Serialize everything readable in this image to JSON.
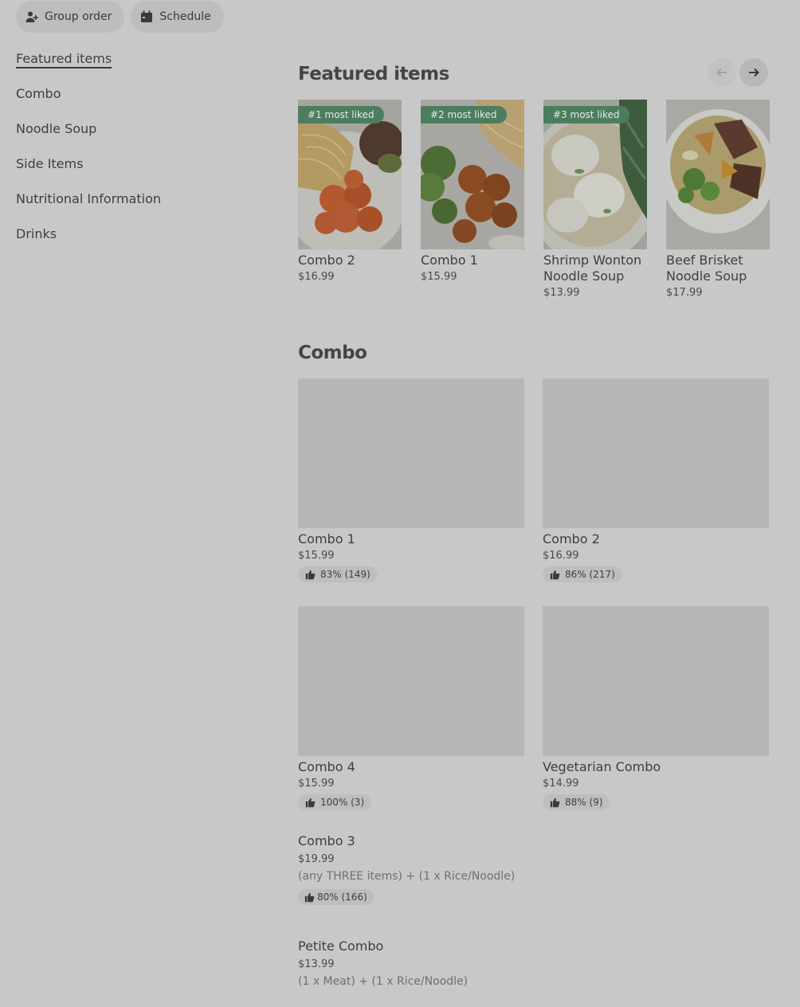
{
  "top_actions": {
    "group_order": "Group order",
    "schedule": "Schedule"
  },
  "sidebar": {
    "items": [
      {
        "label": "Featured items"
      },
      {
        "label": "Combo"
      },
      {
        "label": "Noodle Soup"
      },
      {
        "label": "Side Items"
      },
      {
        "label": "Nutritional Information"
      },
      {
        "label": "Drinks"
      }
    ]
  },
  "featured": {
    "title": "Featured items",
    "items": [
      {
        "badge": "#1 most liked",
        "name": "Combo 2",
        "price": "$16.99"
      },
      {
        "badge": "#2 most liked",
        "name": "Combo 1",
        "price": "$15.99"
      },
      {
        "badge": "#3 most liked",
        "name": "Shrimp Wonton Noodle Soup",
        "price": "$13.99"
      },
      {
        "name": "Beef Brisket Noodle Soup",
        "price": "$17.99"
      }
    ]
  },
  "combo": {
    "title": "Combo",
    "cards": [
      {
        "name": "Combo 1",
        "price": "$15.99",
        "rating": "83% (149)"
      },
      {
        "name": "Combo 2",
        "price": "$16.99",
        "rating": "86% (217)"
      },
      {
        "name": "Combo 4",
        "price": "$15.99",
        "rating": "100% (3)"
      },
      {
        "name": "Vegetarian Combo",
        "price": "$14.99",
        "rating": "88% (9)"
      }
    ],
    "list": [
      {
        "name": "Combo 3",
        "price": "$19.99",
        "description": "(any THREE items) + (1 x Rice/Noodle)",
        "rating": "80% (166)"
      },
      {
        "name": "Petite Combo",
        "price": "$13.99",
        "description": "(1 x Meat) + (1 x Rice/Noodle)"
      }
    ]
  },
  "colors": {
    "background": "#c8c8c8",
    "badge": "#4d7d5f",
    "text": "#3a3a3a"
  }
}
